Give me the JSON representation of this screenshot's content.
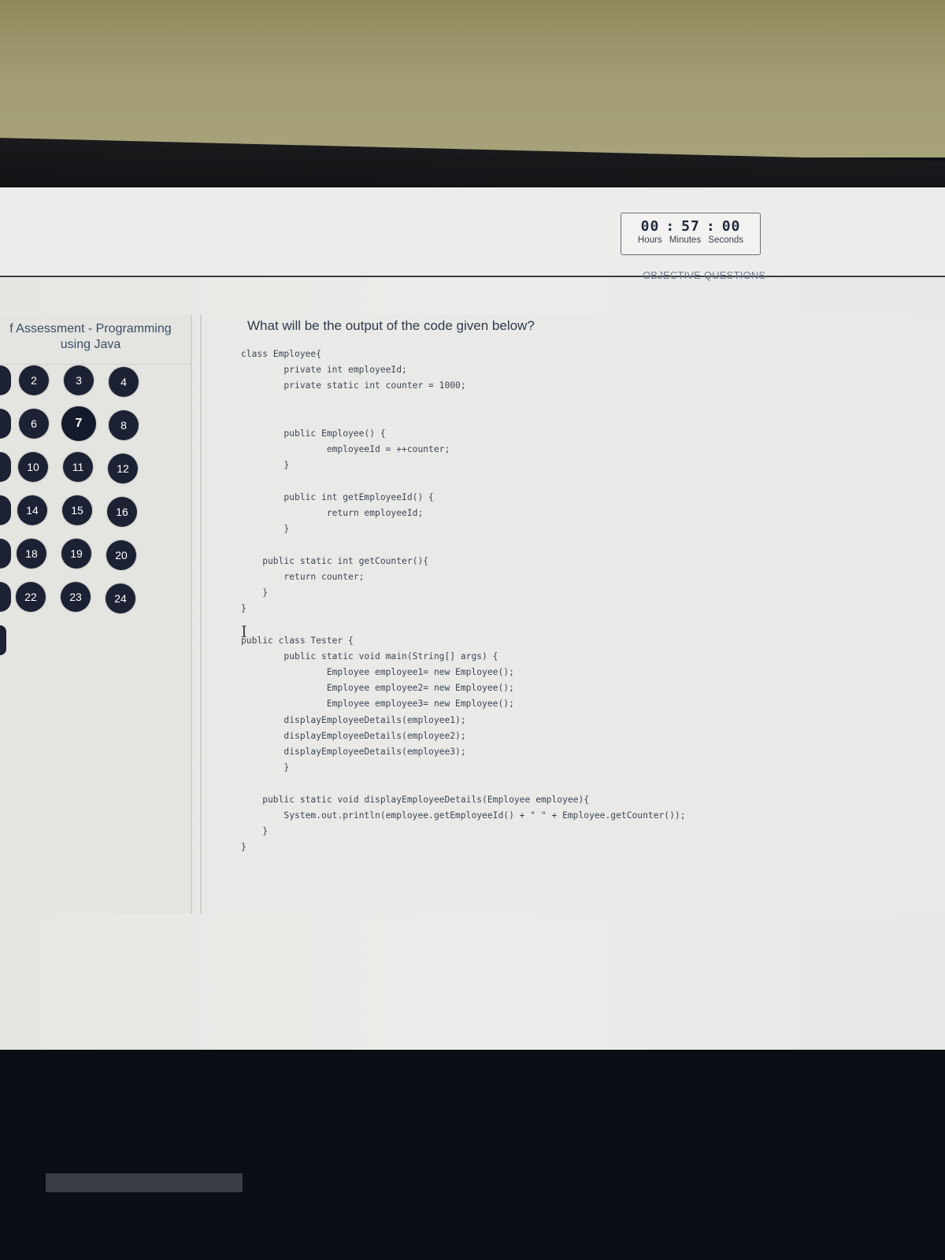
{
  "timer": {
    "hours": "00",
    "minutes": "57",
    "seconds": "00",
    "separator": ":",
    "hours_label": "Hours",
    "minutes_label": "Minutes",
    "seconds_label": "Seconds"
  },
  "section_label": "OBJECTIVE QUESTIONS",
  "sidebar": {
    "title_line1": "f Assessment - Programming",
    "title_line2": "using Java",
    "questions": [
      "2",
      "3",
      "4",
      "6",
      "7",
      "8",
      "10",
      "11",
      "12",
      "14",
      "15",
      "16",
      "18",
      "19",
      "20",
      "22",
      "23",
      "24"
    ],
    "current_question": "7"
  },
  "question": {
    "text": "What will be the output of the code given below?",
    "code": "class Employee{\n        private int employeeId;\n        private static int counter = 1000;\n\n\n        public Employee() {\n                employeeId = ++counter;\n        }\n\n        public int getEmployeeId() {\n                return employeeId;\n        }\n\n    public static int getCounter(){\n        return counter;\n    }\n}\n\npublic class Tester {\n        public static void main(String[] args) {\n                Employee employee1= new Employee();\n                Employee employee2= new Employee();\n                Employee employee3= new Employee();\n        displayEmployeeDetails(employee1);\n        displayEmployeeDetails(employee2);\n        displayEmployeeDetails(employee3);\n        }\n\n    public static void displayEmployeeDetails(Employee employee){\n        System.out.println(employee.getEmployeeId() + \" \" + Employee.getCounter());\n    }\n}"
  },
  "icons": {
    "text_cursor": "I"
  }
}
